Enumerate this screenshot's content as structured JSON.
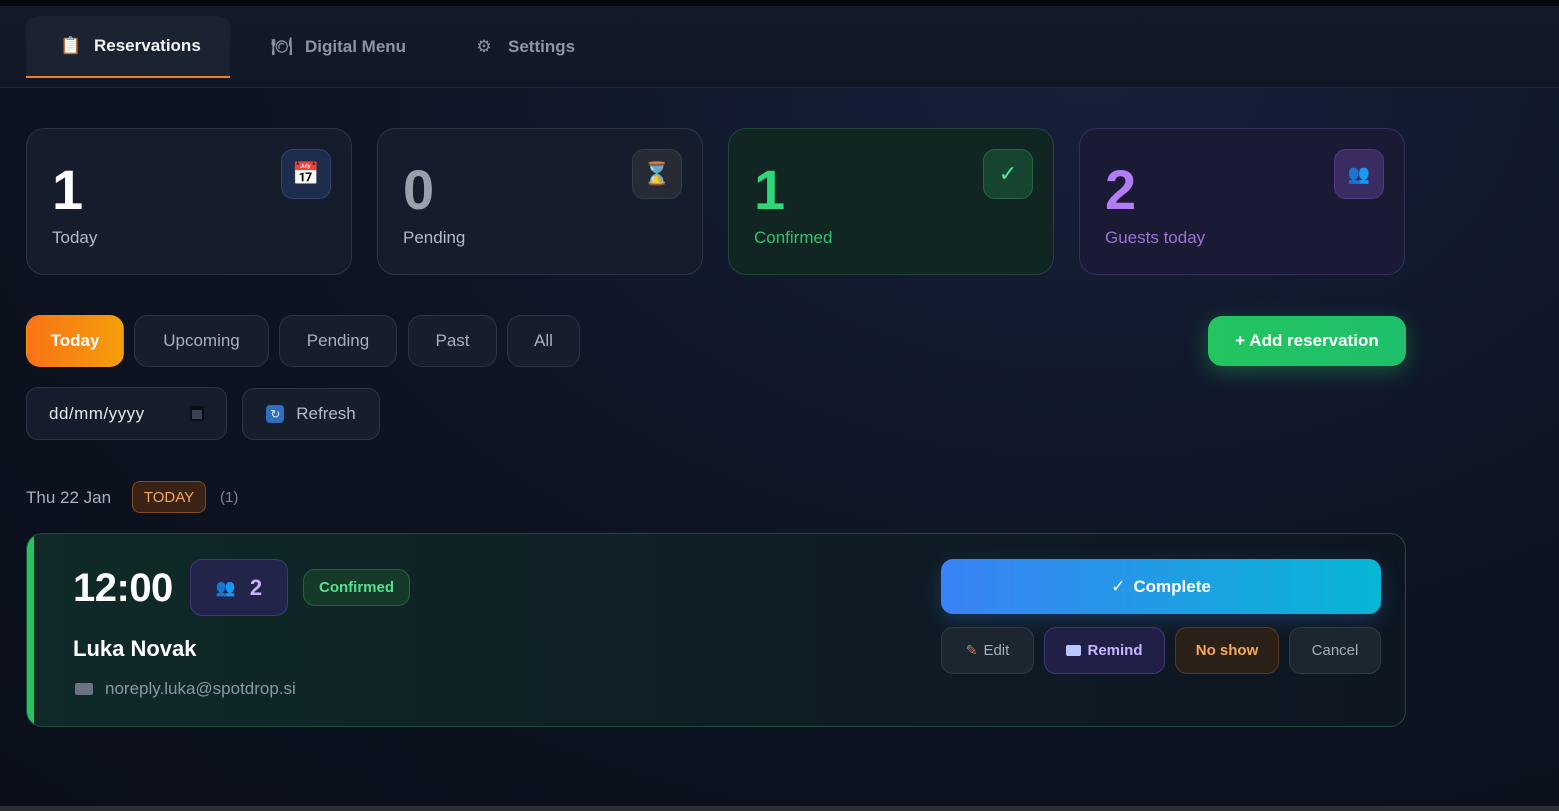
{
  "tabs": [
    {
      "label": "Reservations",
      "icon": "clipboard-icon",
      "glyph": "📋"
    },
    {
      "label": "Digital Menu",
      "icon": "dish-icon",
      "glyph": "🍽"
    },
    {
      "label": "Settings",
      "icon": "gear-icon",
      "glyph": "⚙"
    }
  ],
  "stats": [
    {
      "value": "1",
      "label": "Today",
      "icon": "calendar-icon",
      "glyph": "📅"
    },
    {
      "value": "0",
      "label": "Pending",
      "icon": "hourglass-icon",
      "glyph": "⌛"
    },
    {
      "value": "1",
      "label": "Confirmed",
      "icon": "check-icon",
      "glyph": "✓"
    },
    {
      "value": "2",
      "label": "Guests today",
      "icon": "guests-icon",
      "glyph": "👥"
    }
  ],
  "filters": [
    "Today",
    "Upcoming",
    "Pending",
    "Past",
    "All"
  ],
  "add_button": "+ Add reservation",
  "date_input": {
    "placeholder": "dd/mm/yyyy"
  },
  "refresh_button": "Refresh",
  "day": {
    "label": "Thu 22 Jan",
    "badge": "TODAY",
    "count": "(1)"
  },
  "reservation": {
    "time": "12:00",
    "guests": "2",
    "status": "Confirmed",
    "name": "Luka Novak",
    "email": "noreply.luka@spotdrop.si",
    "complete_label": "Complete",
    "complete_glyph": "✓",
    "actions": {
      "edit": "Edit",
      "remind": "Remind",
      "no_show": "No show",
      "cancel": "Cancel"
    }
  },
  "colors": {
    "accent_orange": "#f97316",
    "success": "#22c55e",
    "purple": "#b27cf5",
    "blue": "#3b82f6"
  }
}
